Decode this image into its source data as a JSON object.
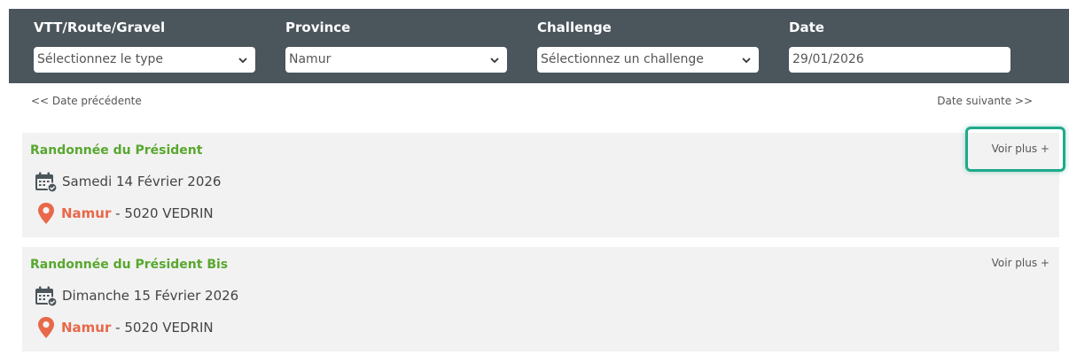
{
  "filters": {
    "type": {
      "label": "VTT/Route/Gravel",
      "value": "Sélectionnez le type"
    },
    "province": {
      "label": "Province",
      "value": "Namur"
    },
    "challenge": {
      "label": "Challenge",
      "value": "Sélectionnez un challenge"
    },
    "date": {
      "label": "Date",
      "value": "29/01/2026"
    }
  },
  "nav": {
    "prev": "<< Date précédente",
    "next": "Date suivante >>"
  },
  "events": [
    {
      "title": "Randonnée du Président",
      "date": "Samedi 14 Février 2026",
      "province": "Namur",
      "locality": "- 5020 VEDRIN",
      "more": "Voir plus +"
    },
    {
      "title": "Randonnée du Président Bis",
      "date": "Dimanche 15 Février 2026",
      "province": "Namur",
      "locality": "- 5020 VEDRIN",
      "more": "Voir plus +"
    }
  ],
  "icons": {
    "calendar": "calendar-icon",
    "location": "map-pin-icon",
    "chevron": "chevron-down-icon"
  },
  "colors": {
    "bar": "#4a555c",
    "title_green": "#58a82f",
    "province_orange": "#e8684a",
    "card_bg": "#f3f2f2",
    "highlight": "#1fa98a"
  }
}
